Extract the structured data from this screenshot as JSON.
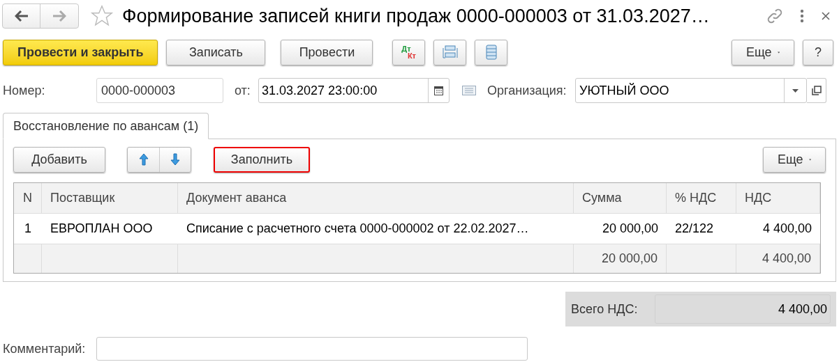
{
  "window": {
    "title": "Формирование записей книги продаж 0000-000003 от 31.03.2027…",
    "favorite": false
  },
  "toolbar": {
    "buttons": [
      {
        "label": "Провести и закрыть",
        "kind": "primary"
      },
      {
        "label": "Записать",
        "kind": "normal"
      },
      {
        "label": "Провести",
        "kind": "normal"
      }
    ],
    "dt_kt": {
      "dt": "Дт",
      "kt": "Кт"
    },
    "more": "Еще",
    "help": "?"
  },
  "fields": {
    "number_label": "Номер:",
    "number": "0000-000003",
    "date_label": "от:",
    "date": "31.03.2027 23:00:00",
    "org_label": "Организация:",
    "org": "УЮТНЫЙ ООО"
  },
  "tabs": [
    {
      "label": "Восстановление по авансам (1)",
      "selected": true
    }
  ],
  "table_toolbar": {
    "add": "Добавить",
    "fill": {
      "label": "Заполнить",
      "highlighted": true
    },
    "more": "Еще"
  },
  "table": {
    "columns": [
      "N",
      "Поставщик",
      "Документ аванса",
      "Сумма",
      "% НДС",
      "НДС"
    ],
    "rows": [
      [
        "1",
        "ЕВРОПЛАН ООО",
        "Списание с расчетного счета 0000-000002 от 22.02.2027…",
        "20 000,00",
        "22/122",
        "4 400,00"
      ]
    ],
    "totals": {
      "sum": "20 000,00",
      "vat": "4 400,00"
    }
  },
  "total_vat": {
    "label": "Всего НДС:",
    "value": "4 400,00"
  },
  "comment": {
    "label": "Комментарий:"
  }
}
